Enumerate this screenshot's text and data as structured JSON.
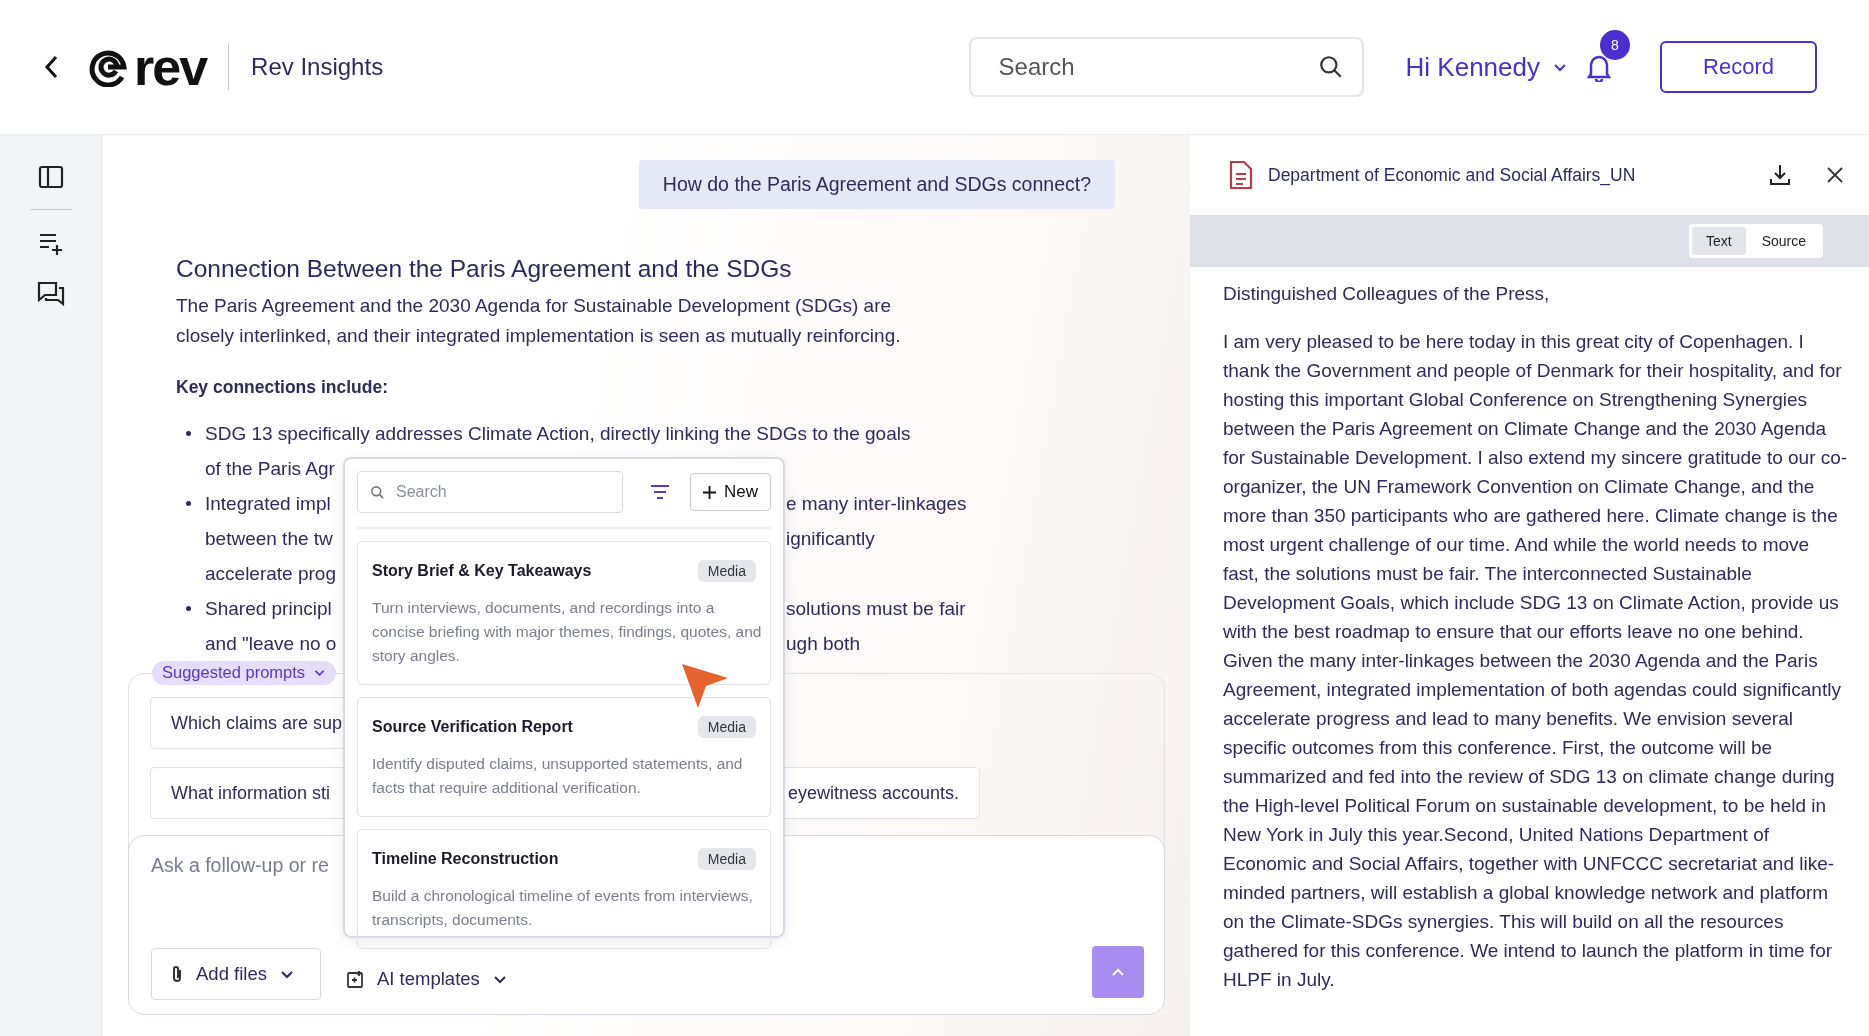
{
  "header": {
    "logo_text": "rev",
    "app_title": "Rev Insights",
    "search": {
      "placeholder": "Search"
    },
    "greeting": "Hi Kennedy",
    "notification_count": "8",
    "record_button": "Record"
  },
  "sidebar": {
    "items": [
      {
        "kind": "panel"
      },
      {
        "kind": "note"
      },
      {
        "kind": "chat"
      }
    ]
  },
  "chat": {
    "question": "How do the Paris Agreement and SDGs connect?",
    "heading": "Connection Between the Paris Agreement and the SDGs",
    "intro": "The Paris Agreement and the 2030 Agenda for Sustainable Development (SDGs) are closely interlinked, and their integrated implementation is seen as mutually reinforcing.",
    "key_label": "Key connections include:",
    "bullets": [
      {
        "lines": [
          {
            "start": "SDG 13 specifically addresses Climate Action, directly linking the SDGs to the goals"
          },
          {
            "start": "of the Paris Agr"
          }
        ]
      },
      {
        "lines": [
          {
            "start": "Integrated impl",
            "end": "e many inter-linkages"
          },
          {
            "start": "between the tw",
            "end": "ignificantly"
          },
          {
            "start": "accelerate prog"
          }
        ]
      },
      {
        "lines": [
          {
            "start": "Shared principl",
            "end": "solutions must be fair"
          },
          {
            "start": "and \"leave no o",
            "end": "ugh both"
          }
        ]
      }
    ],
    "suggested_label": "Suggested prompts",
    "prompts": [
      {
        "start": "Which claims are sup"
      },
      {
        "start": "What information sti",
        "end": "eyewitness accounts."
      }
    ],
    "input": {
      "placeholder": "Ask a follow-up or re"
    },
    "add_files": "Add files",
    "ai_templates": "AI templates"
  },
  "templates_menu": {
    "search": {
      "placeholder": "Search"
    },
    "new_button": "New",
    "items": [
      {
        "title": "Story Brief & Key Takeaways",
        "badge": "Media",
        "description": "Turn interviews, documents, and recordings into a concise briefing with major themes, findings, quotes, and story angles."
      },
      {
        "title": "Source Verification Report",
        "badge": "Media",
        "description": "Identify disputed claims, unsupported statements, and facts that require additional verification."
      },
      {
        "title": "Timeline Reconstruction",
        "badge": "Media",
        "description": "Build a chronological timeline of events from interviews, transcripts, documents."
      }
    ]
  },
  "document": {
    "title": "Department of Economic and Social Affairs_UN",
    "view_tabs": [
      {
        "label": "Text",
        "selected": true
      },
      {
        "label": "Source",
        "selected": false
      }
    ],
    "paragraphs": [
      "Distinguished Colleagues of the Press,",
      "I am very pleased to be here today in this great city of Copenhagen. I thank the Government and people of Denmark for their hospitality, and for hosting this important Global Conference on Strengthening Synergies between the Paris Agreement on Climate Change and the 2030 Agenda for Sustainable Development. I also extend my sincere gratitude to our co-organizer, the UN Framework Convention on Climate Change, and the more than 350 participants who are gathered here. Climate change is the most urgent challenge of our time. And while the world needs to move fast, the solutions must be fair. The interconnected Sustainable Development Goals, which include SDG 13 on Climate Action, provide us with the best roadmap to ensure that our efforts leave no one behind. Given the many inter-linkages between the 2030 Agenda and the Paris Agreement, integrated implementation of both agendas could significantly accelerate progress and lead to many benefits. We envision several specific outcomes from this conference. First, the outcome will be summarized and fed into the review of SDG 13 on climate change during the High-level Political Forum on sustainable development, to be held in New York in July this year.Second, United Nations Department of Economic and Social Affairs, together with UNFCCC secretariat and like-minded partners, will establish a global knowledge network and platform on the Climate-SDGs synergies. This will build on all the resources gathered for this conference. We intend to launch the platform in time for HLPF in July."
    ]
  }
}
